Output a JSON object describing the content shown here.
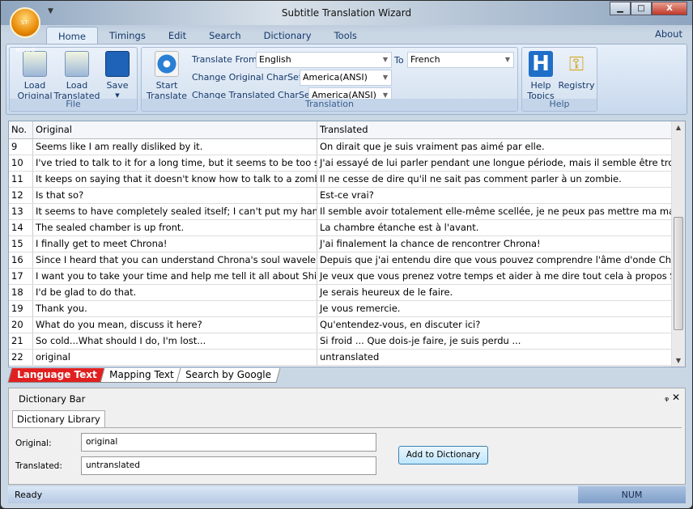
{
  "window": {
    "title": "Subtitle Translation Wizard",
    "orb_label": "ST-Wizard",
    "minimize": "▁",
    "maximize": "□",
    "close": "X"
  },
  "ribbon_tabs": [
    "Home",
    "Timings",
    "Edit",
    "Search",
    "Dictionary",
    "Tools"
  ],
  "about": "About",
  "file_group": {
    "label": "File",
    "load_original": [
      "Load",
      "Original"
    ],
    "load_translated": [
      "Load",
      "Translated"
    ],
    "save": "Save"
  },
  "translation_group": {
    "label": "Translation",
    "start": [
      "Start",
      "Translate"
    ],
    "translate_from_label": "Translate From",
    "translate_from": "English",
    "to_label": "To",
    "to": "French",
    "orig_charset_label": "Change Original CharSet",
    "orig_charset": "America(ANSI)",
    "trans_charset_label": "Change Translated CharSet",
    "trans_charset": "America(ANSI)"
  },
  "help_group": {
    "label": "Help",
    "help_topics": [
      "Help",
      "Topics"
    ],
    "registry": "Registry"
  },
  "grid": {
    "columns": [
      "No.",
      "Original",
      "Translated"
    ],
    "rows": [
      [
        "9",
        "Seems like I am really disliked by it.",
        "On dirait que je suis vraiment pas aimé par elle."
      ],
      [
        "10",
        "I've tried to talk to it for a long time, but it seems to be too scare...",
        "J'ai essayé de lui parler pendant une longue période, mais il semble être trop effr..."
      ],
      [
        "11",
        "It keeps on saying that it doesn't know how to talk to a zombie.",
        "Il ne cesse de dire qu'il ne sait pas comment parler à un zombie."
      ],
      [
        "12",
        "Is that so?",
        "Est-ce vrai?"
      ],
      [
        "13",
        "It seems to have completely sealed itself; I can't put my hand in.",
        "Il semble avoir totalement elle-même scellée, je ne peux pas mettre ma main po"
      ],
      [
        "14",
        "The sealed chamber is up front.",
        "La chambre étanche est à l'avant."
      ],
      [
        "15",
        "I finally get to meet Chrona!",
        "J'ai finalement la chance de rencontrer Chrona!"
      ],
      [
        "16",
        "Since I heard that you can understand Chrona's soul wavelengt...",
        "Depuis que j'ai entendu dire que vous pouvez comprendre l'âme d'onde Chrona ..."
      ],
      [
        "17",
        "I want you to take your time and help me tell it all about Shibus...",
        "Je veux que vous prenez votre temps et aider à me dire tout cela à propos Shibus..."
      ],
      [
        "18",
        "I'd be glad to do that.",
        "Je serais heureux de le faire."
      ],
      [
        "19",
        "Thank you.",
        "Je vous remercie."
      ],
      [
        "20",
        "What do you mean, discuss it here?",
        "Qu'entendez-vous, en discuter ici?"
      ],
      [
        "21",
        "So cold...What should I do, I'm lost...",
        "Si froid ... Que dois-je faire, je suis perdu ..."
      ],
      [
        "22",
        "original",
        "untranslated"
      ]
    ]
  },
  "bottom_tabs": [
    "Language Text",
    "Mapping Text",
    "Search by Google"
  ],
  "dictionary": {
    "title": "Dictionary Bar",
    "tab": "Dictionary Library",
    "original_label": "Original:",
    "original_value": "original",
    "translated_label": "Translated:",
    "translated_value": "untranslated",
    "add_button": "Add to Dictionary"
  },
  "status": {
    "text": "Ready",
    "num": "NUM"
  }
}
